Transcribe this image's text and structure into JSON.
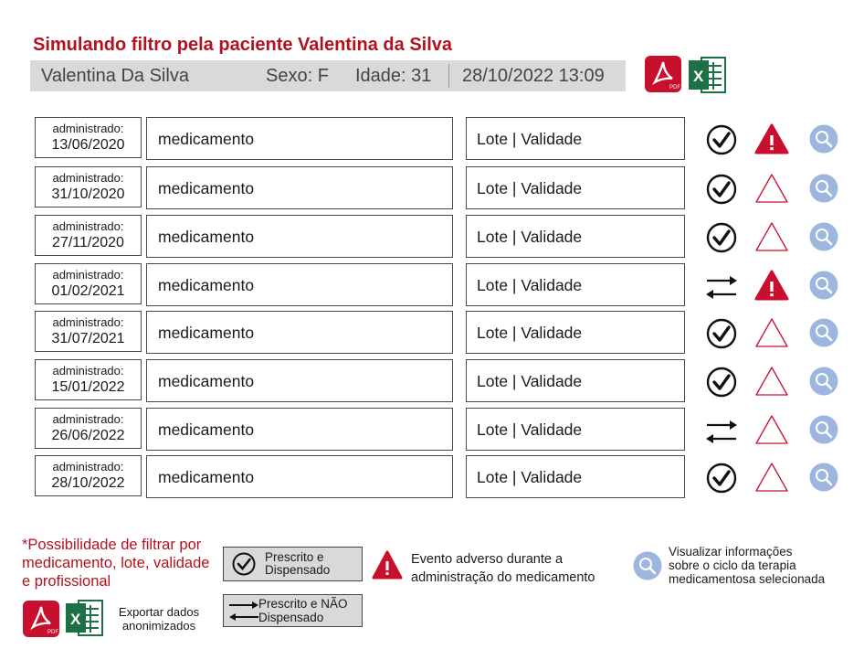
{
  "title": "Simulando filtro pela paciente Valentina da Silva",
  "patient": {
    "name": "Valentina Da Silva",
    "sex": "Sexo: F",
    "age": "Idade: 31",
    "datetime": "28/10/2022 13:09"
  },
  "header_exports": {
    "pdf_icon": "pdf-icon",
    "excel_icon": "excel-icon",
    "pdf_text": "PDF",
    "excel_text": "X"
  },
  "rows": [
    {
      "label": "administrado:",
      "date": "13/06/2020",
      "med": "medicamento",
      "lote": "Lote | Validade",
      "status": "dispensed",
      "adverse": true,
      "search_icon": "magnifier-icon"
    },
    {
      "label": "administrado:",
      "date": "31/10/2020",
      "med": "medicamento",
      "lote": "Lote | Validade",
      "status": "dispensed",
      "adverse": false,
      "search_icon": "magnifier-icon"
    },
    {
      "label": "administrado:",
      "date": "27/11/2020",
      "med": "medicamento",
      "lote": "Lote | Validade",
      "status": "dispensed",
      "adverse": false,
      "search_icon": "magnifier-icon"
    },
    {
      "label": "administrado:",
      "date": "01/02/2021",
      "med": "medicamento",
      "lote": "Lote | Validade",
      "status": "not-dispensed",
      "adverse": true,
      "search_icon": "magnifier-icon"
    },
    {
      "label": "administrado:",
      "date": "31/07/2021",
      "med": "medicamento",
      "lote": "Lote | Validade",
      "status": "dispensed",
      "adverse": false,
      "search_icon": "magnifier-icon"
    },
    {
      "label": "administrado:",
      "date": "15/01/2022",
      "med": "medicamento",
      "lote": "Lote | Validade",
      "status": "dispensed",
      "adverse": false,
      "search_icon": "magnifier-icon"
    },
    {
      "label": "administrado:",
      "date": "26/06/2022",
      "med": "medicamento",
      "lote": "Lote | Validade",
      "status": "not-dispensed",
      "adverse": false,
      "search_icon": "magnifier-icon"
    },
    {
      "label": "administrado:",
      "date": "28/10/2022",
      "med": "medicamento",
      "lote": "Lote | Validade",
      "status": "dispensed",
      "adverse": false,
      "search_icon": "magnifier-icon"
    }
  ],
  "footnote": "*Possibilidade de filtrar por medicamento, lote, validade e profissional",
  "export_label": "Exportar dados anonimizados",
  "legend": {
    "dispensed_line1": "Prescrito e",
    "dispensed_line2": "Dispensado",
    "not_dispensed_line1": "Prescrito e NÃO",
    "not_dispensed_line2": "Dispensado",
    "adverse_line1": "Evento adverso durante a",
    "adverse_line2": "administração do medicamento",
    "info_line1": "Visualizar informações",
    "info_line2": "sobre o ciclo da terapia",
    "info_line3": "medicamentosa selecionada"
  },
  "colors": {
    "accent_red": "#b2121d",
    "alert_red": "#c8102e",
    "search_blue": "#9db6e0",
    "excel_green": "#1e7145",
    "bar_gray": "#d9d9d9"
  }
}
